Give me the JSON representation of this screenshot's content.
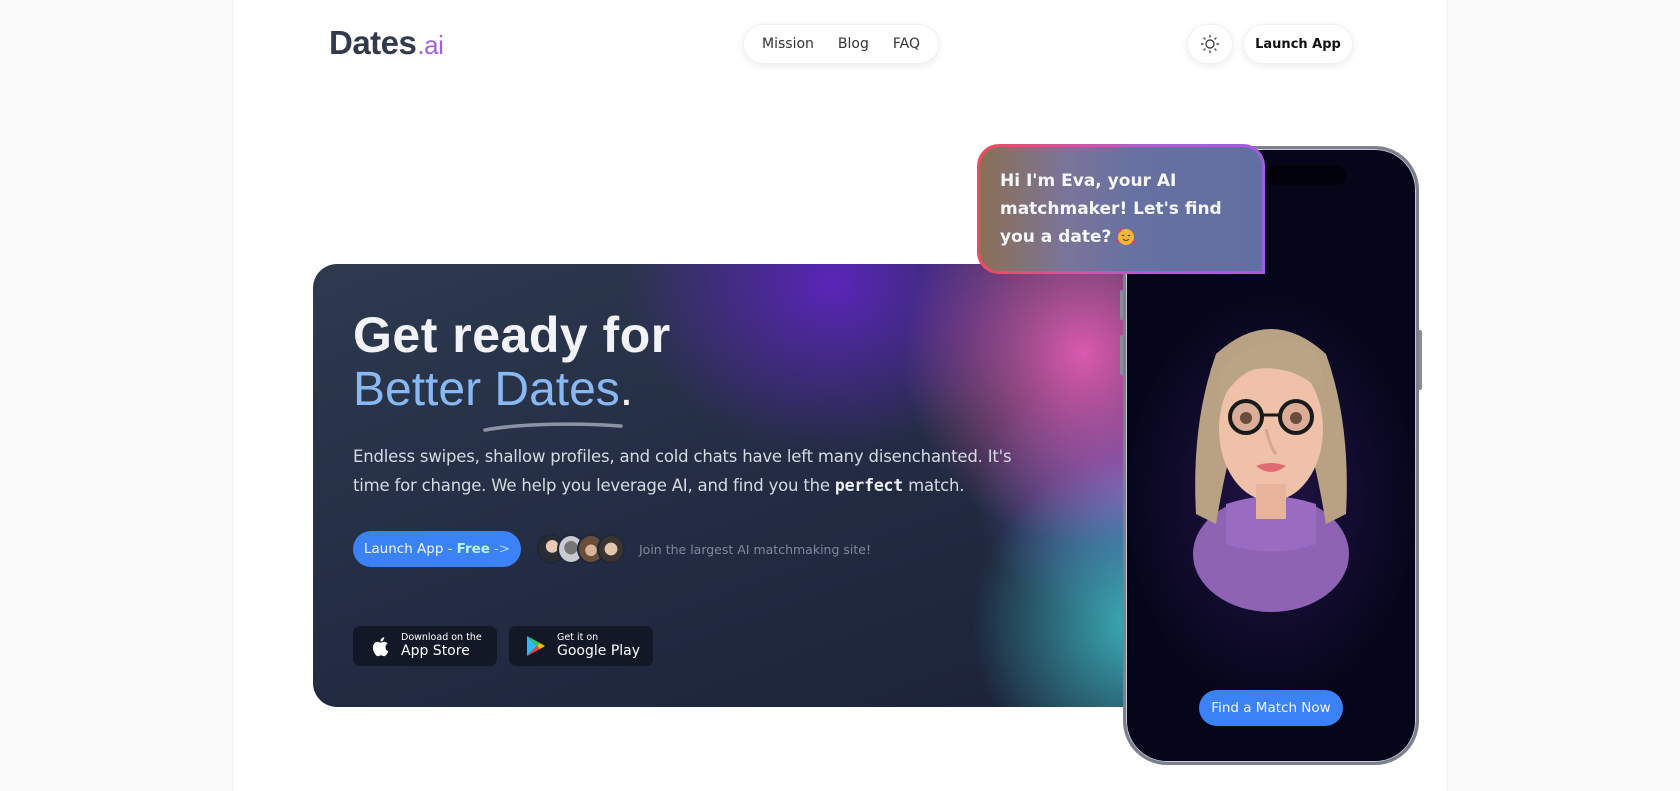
{
  "header": {
    "logo_main": "Dates",
    "logo_suffix": ".ai",
    "nav": [
      {
        "label": "Mission"
      },
      {
        "label": "Blog"
      },
      {
        "label": "FAQ"
      }
    ],
    "theme_toggle_icon": "sun-icon",
    "launch_label": "Launch App"
  },
  "hero": {
    "title_line1": "Get ready for",
    "title_line2": "Better Dates",
    "title_period": ".",
    "description_before": "Endless swipes, shallow profiles, and cold chats have left many disenchanted. It's time for change. We help you leverage AI, and find you the ",
    "description_emphasis": "perfect",
    "description_after": " match.",
    "cta_label": "Launch App - ",
    "cta_free": "Free",
    "cta_arrow": "->",
    "social_proof": "Join the largest AI matchmaking site!",
    "avatar_count": 4,
    "stores": [
      {
        "icon": "apple-icon",
        "small": "Download on the",
        "big": "App Store"
      },
      {
        "icon": "google-play-icon",
        "small": "Get it on",
        "big": "Google Play"
      }
    ]
  },
  "phone": {
    "chat_message": "Hi I'm Eva, your AI matchmaker! Let's find you a date?",
    "chat_emoji": "smiling-face-with-hearts",
    "avatar_name": "Eva",
    "match_button": "Find a Match Now"
  },
  "colors": {
    "accent_blue": "#3b82f6",
    "logo_purple": "#a262e0",
    "headline_blue": "#8ab8f3",
    "hero_dark": "#232c42"
  }
}
